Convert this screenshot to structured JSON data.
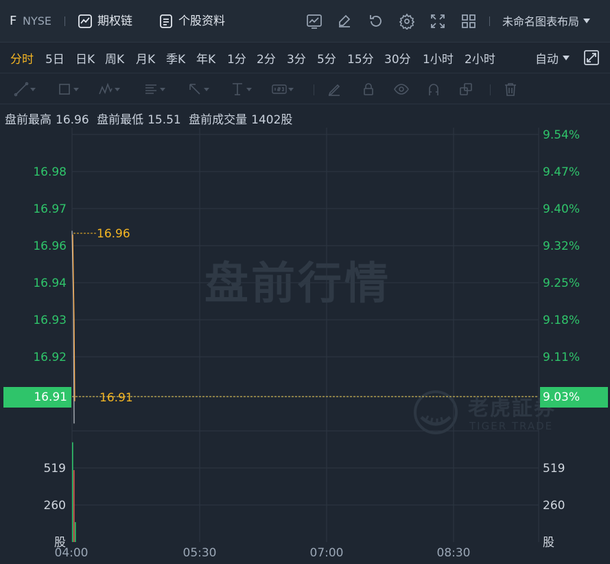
{
  "header": {
    "ticker": "F",
    "exchange": "NYSE",
    "options_chain_label": "期权链",
    "stock_profile_label": "个股资料",
    "layout_label": "未命名图表布局",
    "icons": [
      "chart-line-icon",
      "edit-icon",
      "refresh-icon",
      "settings-icon",
      "fullscreen-icon",
      "grid-layout-icon"
    ]
  },
  "periods": [
    "分时",
    "5日",
    "日K",
    "周K",
    "月K",
    "季K",
    "年K",
    "1分",
    "2分",
    "3分",
    "5分",
    "15分",
    "30分",
    "1小时",
    "2小时"
  ],
  "active_period": "分时",
  "scale_mode": "自动",
  "draw_tools": [
    "line-tool-icon",
    "rect-tool-icon",
    "pattern-tool-icon",
    "fib-tool-icon",
    "arrow-tool-icon",
    "measure-tool-icon",
    "text-tool-icon",
    "brush-icon",
    "lock-icon",
    "eye-icon",
    "magnet-icon",
    "layers-icon",
    "trash-icon"
  ],
  "premarket": {
    "high_label": "盘前最高",
    "high_value": "16.96",
    "low_label": "盘前最低",
    "low_value": "15.51",
    "volume_label": "盘前成交量",
    "volume_value": "1402股"
  },
  "watermark": "盘前行情",
  "brand": {
    "cn": "老虎証券",
    "en": "TIGER TRADE"
  },
  "colors": {
    "up": "#2fc46a",
    "down": "#e0524f",
    "accent": "#f5b623",
    "price_line": "#b7bcc3",
    "avg_line": "#f0a040"
  },
  "chart_data": {
    "type": "line",
    "price_axis_left": [
      "16.98",
      "16.97",
      "16.96",
      "16.94",
      "16.93",
      "16.92",
      "16.91"
    ],
    "price_axis_right": [
      "9.54%",
      "9.47%",
      "9.40%",
      "9.32%",
      "9.25%",
      "9.18%",
      "9.11%",
      "9.03%"
    ],
    "volume_axis": [
      "519",
      "260",
      "股"
    ],
    "time_axis": [
      "04:00",
      "05:30",
      "07:00",
      "08:30"
    ],
    "current_price": "16.91",
    "current_pct": "9.03%",
    "high_marker": "16.96",
    "last_marker": "16.91",
    "price_series": [
      {
        "t": "04:00",
        "price": 16.964
      },
      {
        "t": "04:00",
        "price": 16.945
      },
      {
        "t": "04:01",
        "price": 16.912
      }
    ],
    "avg_series": [
      {
        "t": "04:00",
        "price": 16.963
      },
      {
        "t": "04:00",
        "price": 16.94
      },
      {
        "t": "04:01",
        "price": 16.918
      }
    ],
    "volume_bars": [
      {
        "t": "04:00",
        "volume": 700,
        "dir": "up"
      },
      {
        "t": "04:00",
        "volume": 505,
        "dir": "down"
      },
      {
        "t": "04:01",
        "volume": 140,
        "dir": "up"
      }
    ],
    "volume_max": 780
  }
}
